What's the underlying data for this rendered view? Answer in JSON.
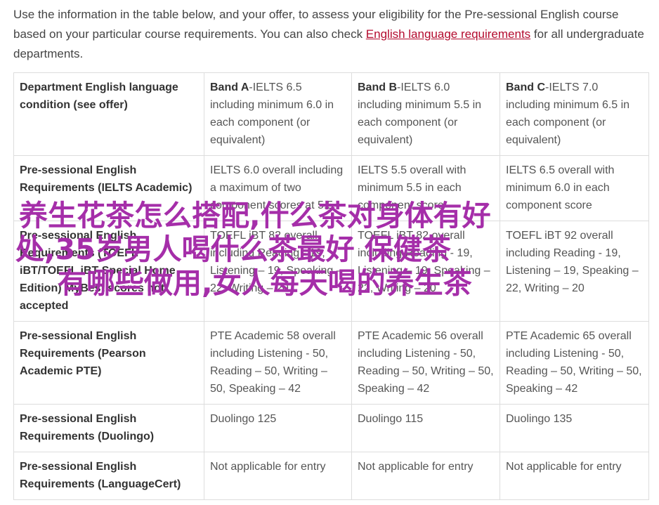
{
  "intro": {
    "text_before": "Use the information in the table below, and your offer, to assess your eligibility for the Pre-sessional English course based on your particular course requirements. You can also check ",
    "link_text": "English language requirements",
    "text_after": " for all undergraduate departments."
  },
  "table": {
    "header": {
      "label": "Department English language condition (see offer)",
      "bands": [
        {
          "name": "Band A",
          "text": "-IELTS 6.5 including minimum 6.0 in each component (or equivalent)"
        },
        {
          "name": "Band B",
          "text": "-IELTS 6.0 including minimum 5.5 in each component (or equivalent)"
        },
        {
          "name": "Band C",
          "text": "-IELTS 7.0 including minimum 6.5 in each component (or equivalent)"
        }
      ]
    },
    "rows": [
      {
        "label": "Pre-sessional English Requirements (IELTS Academic)",
        "cells": [
          "IELTS 6.0 overall including a maximum of two component scores at 5.5",
          "IELTS 5.5 overall with minimum 5.5 in each component score",
          "IELTS 6.5 overall with minimum 6.0 in each component score"
        ]
      },
      {
        "label": "Pre-sessional English Requirements (TOEFL iBT/TOEFL iBT Special Home Edition) MyBest scores not accepted",
        "cells": [
          "TOEFL iBT 82 overall including Reading - 19, Listening – 19, Speaking – 22, Writing – 20",
          "TOEFL iBT 82 overall including Reading - 19, Listening – 19, Speaking – 22, Writing – 20",
          "TOEFL iBT 92 overall including Reading - 19, Listening – 19, Speaking – 22, Writing – 20"
        ]
      },
      {
        "label": "Pre-sessional English Requirements (Pearson Academic PTE)",
        "cells": [
          "PTE Academic 58 overall including Listening - 50, Reading – 50, Writing – 50, Speaking – 42",
          "PTE Academic 56 overall including Listening - 50, Reading – 50, Writing – 50, Speaking – 42",
          "PTE Academic 65 overall including Listening - 50, Reading – 50, Writing – 50, Speaking – 42"
        ]
      },
      {
        "label": "Pre-sessional English Requirements (Duolingo)",
        "cells": [
          "Duolingo 125",
          "Duolingo 115",
          "Duolingo 135"
        ]
      },
      {
        "label": "Pre-sessional English Requirements (LanguageCert)",
        "cells": [
          "Not applicable for entry",
          "Not applicable for entry",
          "Not applicable for entry"
        ]
      }
    ]
  },
  "overlay": {
    "line1": "养生花茶怎么搭配,什么茶对身体有好",
    "line2": "处,35岁男人喝什么茶最好 保健茶",
    "line3": "有哪些做用,女人每天喝的养生茶",
    "color": "#a52ea9"
  }
}
